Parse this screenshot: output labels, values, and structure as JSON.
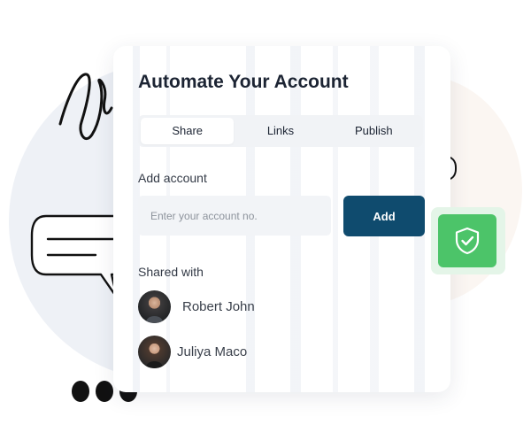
{
  "card": {
    "title": "Automate Your Account",
    "tabs": [
      {
        "label": "Share",
        "active": true
      },
      {
        "label": "Links",
        "active": false
      },
      {
        "label": "Publish",
        "active": false
      }
    ],
    "add_account": {
      "label": "Add account",
      "input_placeholder": "Enter your account no.",
      "input_value": "",
      "button_label": "Add"
    },
    "shared_with": {
      "label": "Shared with",
      "people": [
        {
          "name": "Robert John"
        },
        {
          "name": "Juliya Maco"
        }
      ]
    }
  },
  "icons": {
    "badge": "shield-check-icon",
    "speech_large": "speech-bubble-icon",
    "speech_small": "speech-bubble-icon",
    "scribble": "scribble-doodle",
    "dots": "ellipsis-dots-icon"
  },
  "colors": {
    "accent": "#0f4b6e",
    "badge_green": "#4cc469",
    "badge_bg": "#e4f5e8",
    "text_dark": "#1c2433",
    "tab_bg": "#f1f3f6",
    "input_bg": "#f2f4f7"
  }
}
